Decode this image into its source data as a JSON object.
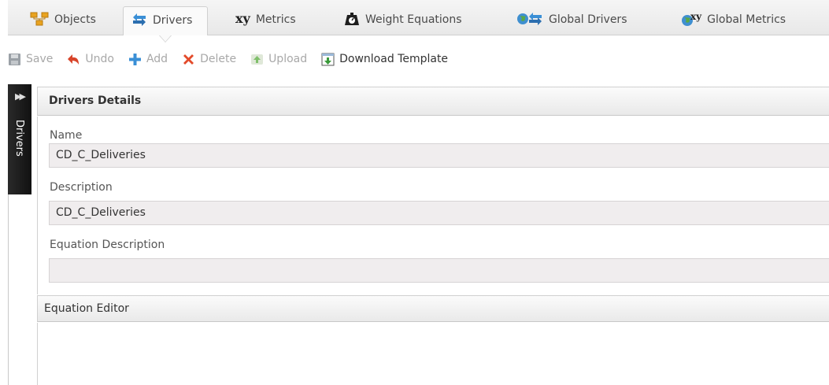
{
  "tabs": [
    {
      "label": "Objects",
      "icon": "objects-icon"
    },
    {
      "label": "Drivers",
      "icon": "drivers-icon",
      "active": true
    },
    {
      "label": "Metrics",
      "icon": "xy-icon",
      "icon_text": "xy"
    },
    {
      "label": "Weight Equations",
      "icon": "scale-icon"
    },
    {
      "label": "Global Drivers",
      "icon": "globe-drivers-icon"
    },
    {
      "label": "Global Metrics",
      "icon": "globe-xy-icon",
      "icon_text": "xy"
    }
  ],
  "toolbar": {
    "save": "Save",
    "undo": "Undo",
    "add": "Add",
    "delete": "Delete",
    "upload": "Upload",
    "download": "Download Template"
  },
  "rail": {
    "label": "Drivers"
  },
  "details": {
    "title": "Drivers Details",
    "name_label": "Name",
    "name_value": "CD_C_Deliveries",
    "description_label": "Description",
    "description_value": "CD_C_Deliveries",
    "equation_description_label": "Equation Description",
    "equation_description_value": ""
  },
  "editor": {
    "title": "Equation Editor"
  },
  "colors": {
    "rail_bg": "#1a1a1a",
    "input_bg": "#f0edee",
    "add_blue": "#3a8fd6",
    "delete_red": "#e34a2a",
    "undo_red": "#d8442a",
    "download_green": "#3a9a3a"
  }
}
